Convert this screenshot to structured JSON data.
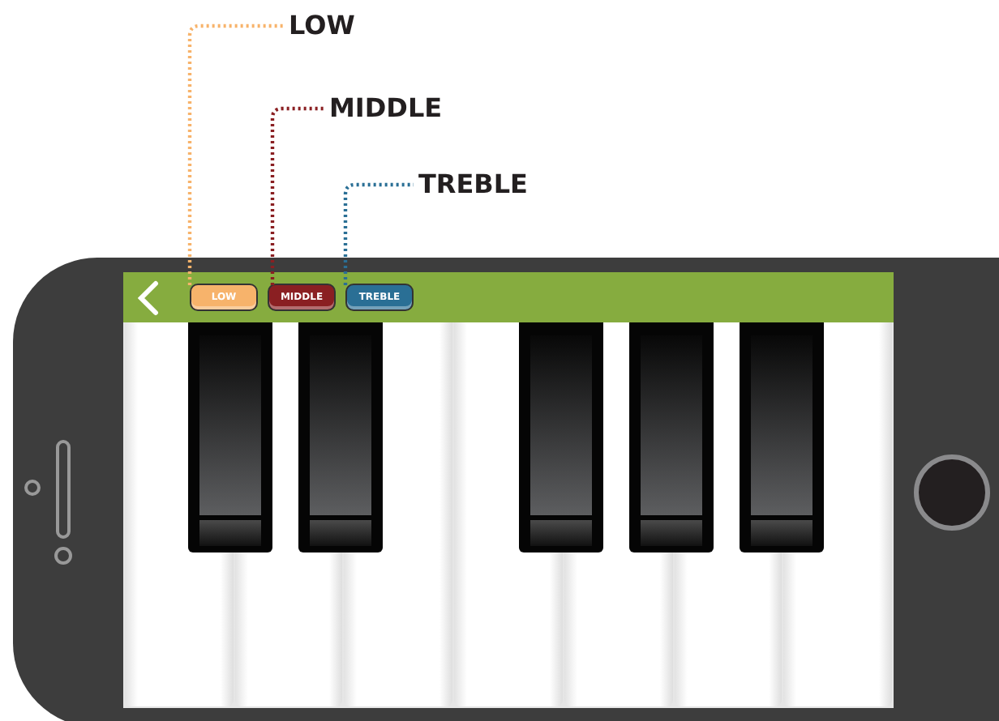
{
  "toolbar": {
    "buttons": [
      {
        "label": "LOW",
        "color": "#f7b36b"
      },
      {
        "label": "MIDDLE",
        "color": "#8a1f22"
      },
      {
        "label": "TREBLE",
        "color": "#2a6f95"
      }
    ]
  },
  "callouts": [
    {
      "label": "LOW"
    },
    {
      "label": "MIDDLE"
    },
    {
      "label": "TREBLE"
    }
  ]
}
